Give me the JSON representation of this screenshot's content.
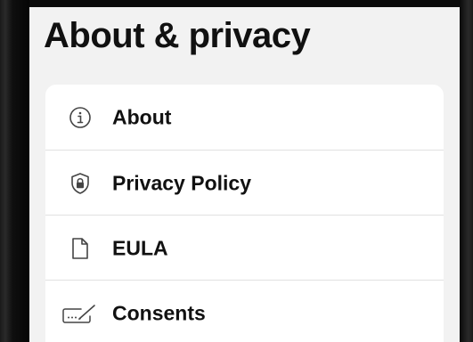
{
  "page": {
    "title": "About & privacy"
  },
  "menu": {
    "items": [
      {
        "label": "About",
        "icon": "info-circle-icon"
      },
      {
        "label": "Privacy Policy",
        "icon": "shield-lock-icon"
      },
      {
        "label": "EULA",
        "icon": "document-icon"
      },
      {
        "label": "Consents",
        "icon": "signature-icon"
      }
    ]
  },
  "colors": {
    "background": "#f2f2f2",
    "card": "#ffffff",
    "text": "#111111",
    "divider": "#e1e1e1"
  }
}
